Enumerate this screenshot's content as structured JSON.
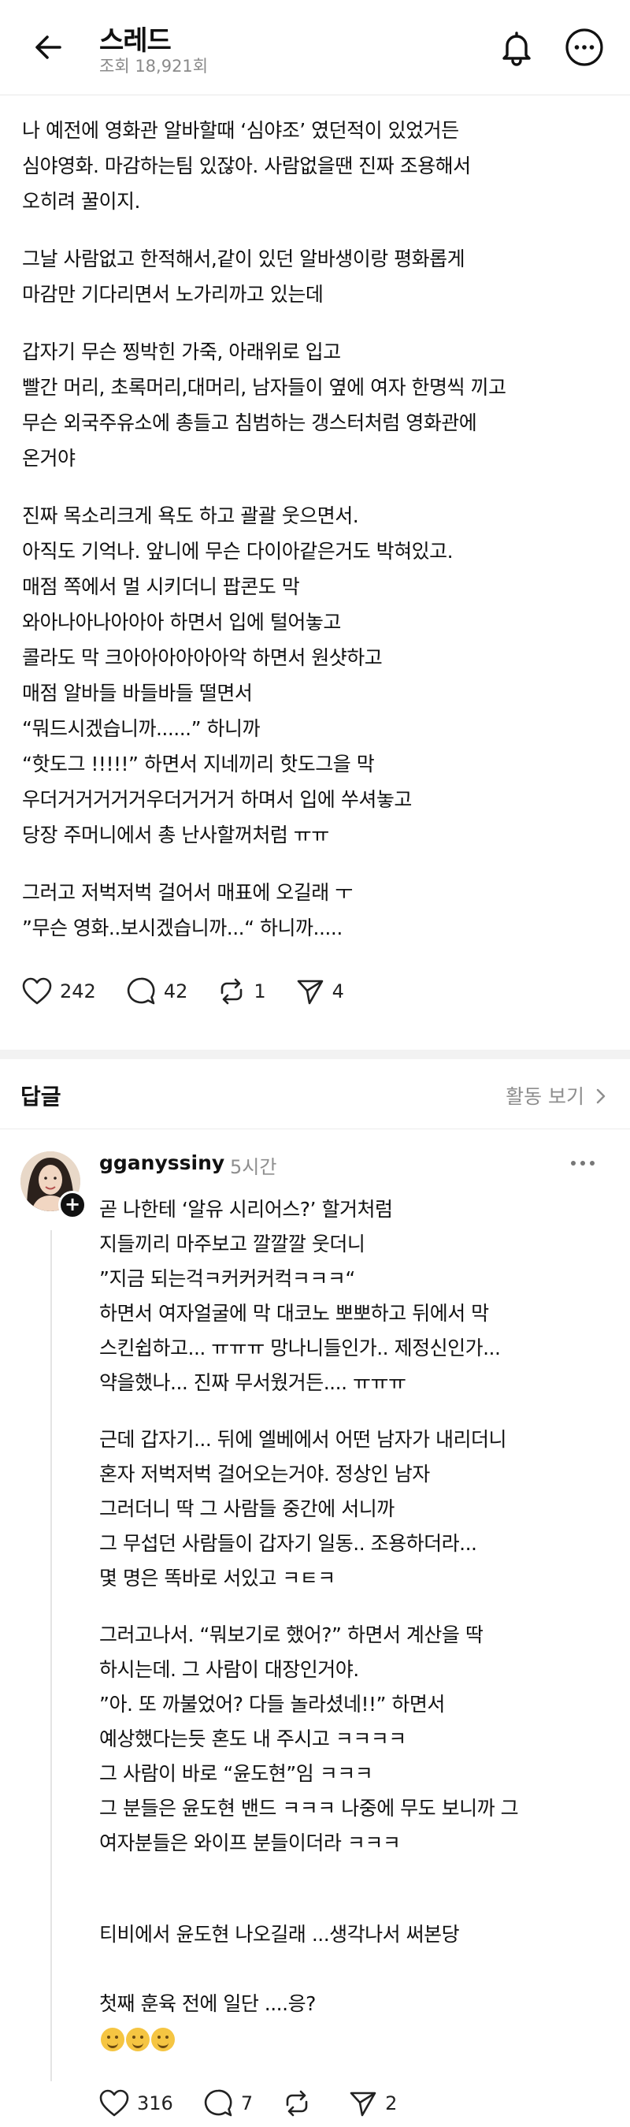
{
  "header": {
    "title": "스레드",
    "views": "조회 18,921회"
  },
  "post": {
    "paragraphs": [
      "나 예전에 영화관 알바할때 ‘심야조’ 였던적이 있었거든\n심야영화. 마감하는팀 있잖아. 사람없을땐 진짜 조용해서\n오히려 꿀이지.",
      "그날 사람없고 한적해서,같이 있던 알바생이랑 평화롭게\n마감만 기다리면서 노가리까고 있는데",
      "갑자기 무슨 찡박힌 가죽, 아래위로 입고\n빨간 머리, 초록머리,대머리, 남자들이 옆에 여자 한명씩 끼고\n무슨 외국주유소에 총들고 침범하는 갱스터처럼 영화관에\n온거야",
      "진짜 목소리크게 욕도 하고 괄괄 웃으면서.\n아직도 기억나. 앞니에 무슨 다이아같은거도 박혀있고.\n매점 쪽에서 멀 시키더니 팝콘도 막\n와아나아나아아아 하면서 입에 털어놓고\n콜라도 막 크아아아아아아악 하면서 원샷하고\n매점 알바들 바들바들 떨면서\n“뭐드시겠습니까......” 하니까\n“핫도그 !!!!!” 하면서 지네끼리 핫도그을 막\n우더거거거거거우더거거거 하며서 입에 쑤셔놓고\n당장 주머니에서 총 난사할꺼처럼 ㅠㅠ",
      "그러고 저벅저벅 걸어서 매표에 오길래 ㅜ\n”무슨 영화..보시겠습니까...“ 하니까....."
    ],
    "likes": "242",
    "comments": "42",
    "reposts": "1",
    "shares": "4"
  },
  "replies": {
    "title": "답글",
    "activity_link": "활동 보기"
  },
  "comment": {
    "username": "gganyssiny",
    "time": "5시간",
    "paragraphs": [
      "곧 나한테 ‘알유 시리어스?’ 할거처럼\n지들끼리 마주보고 깔깔깔 웃더니\n”지금 되는걱ㅋ커커커컥ㅋㅋㅋ“\n하면서 여자얼굴에 막 대코노 뽀뽀하고 뒤에서 막\n스킨쉽하고... ㅠㅠㅠ 망나니들인가.. 제정신인가...\n약을했나... 진짜 무서웠거든.... ㅠㅠㅠ",
      "근데 갑자기... 뒤에 엘베에서 어떤 남자가 내리더니\n혼자 저벅저벅 걸어오는거야. 정상인 남자\n그러더니 딱 그 사람들 중간에 서니까\n그 무섭던 사람들이 갑자기 일동.. 조용하더라...\n몇 명은 똑바로 서있고 ㅋㅌㅋ",
      "그러고나서. “뭐보기로 했어?” 하면서 계산을 딱\n하시는데. 그 사람이 대장인거야.\n”아. 또 까불었어? 다들 놀라셨네!!” 하면서\n예상했다는듯 혼도 내 주시고 ㅋㅋㅋㅋ\n그 사람이 바로 “윤도현”임 ㅋㅋㅋ\n그 분들은 윤도현 밴드 ㅋㅋㅋ 나중에 무도 보니까 그\n여자분들은 와이프 분들이더라 ㅋㅋㅋ",
      "티비에서 윤도현 나오길래 ...생각나서 써본당"
    ],
    "last_line": "첫째 훈육 전에 일단 ....응?",
    "likes": "316",
    "comments": "7",
    "shares": "2"
  },
  "colors": {
    "text": "#111111",
    "muted": "#8e8e8e",
    "divider": "#f2f2f2"
  }
}
